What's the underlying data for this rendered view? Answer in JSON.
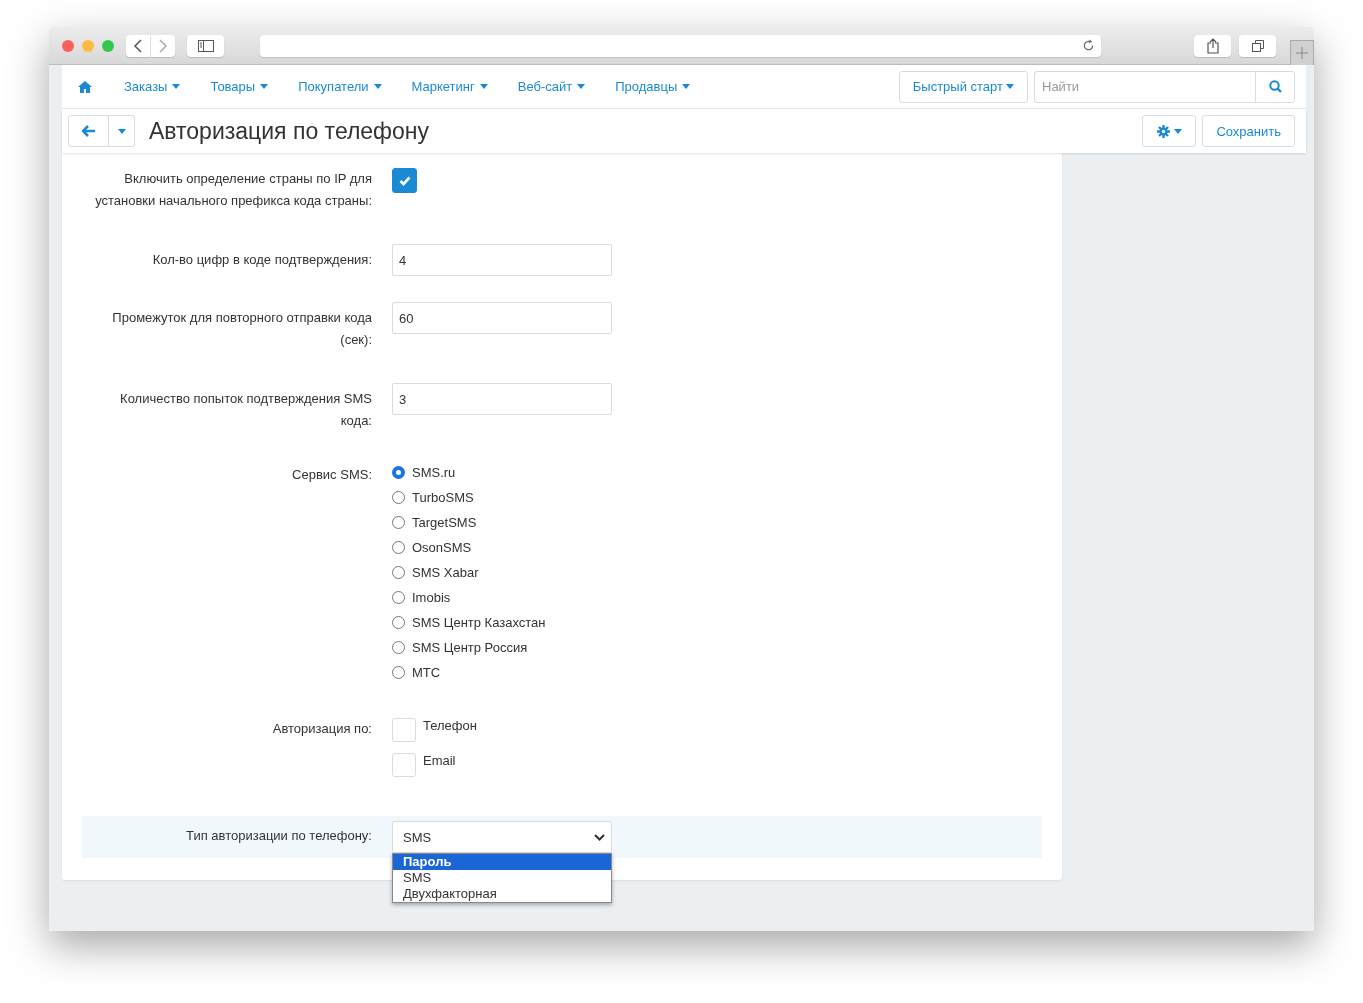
{
  "nav": {
    "items": [
      {
        "label": "Заказы"
      },
      {
        "label": "Товары"
      },
      {
        "label": "Покупатели"
      },
      {
        "label": "Маркетинг"
      },
      {
        "label": "Веб-сайт"
      },
      {
        "label": "Продавцы"
      }
    ],
    "quick_start": "Быстрый старт",
    "search": {
      "placeholder": "Найти"
    }
  },
  "header": {
    "title": "Авторизация по телефону",
    "save": "Сохранить"
  },
  "form": [
    {
      "kind": "checkbox",
      "label": "Включить определение страны по IP для установки начального префикса кода страны:",
      "checked": true
    },
    {
      "kind": "input",
      "label": "Кол-во цифр в коде подтверждения:",
      "value": "4"
    },
    {
      "kind": "input",
      "label": "Промежуток для повторного отправки кода (сек):",
      "value": "60"
    },
    {
      "kind": "input",
      "label": "Количество попыток подтверждения SMS кода:",
      "value": "3"
    },
    {
      "kind": "radio",
      "label": "Сервис SMS:",
      "options": [
        {
          "label": "SMS.ru",
          "selected": true
        },
        {
          "label": "TurboSMS",
          "selected": false
        },
        {
          "label": "TargetSMS",
          "selected": false
        },
        {
          "label": "OsonSMS",
          "selected": false
        },
        {
          "label": "SMS Xabar",
          "selected": false
        },
        {
          "label": "Imobis",
          "selected": false
        },
        {
          "label": "SMS Центр Казахстан",
          "selected": false
        },
        {
          "label": "SMS Центр Россия",
          "selected": false
        },
        {
          "label": "МТС",
          "selected": false
        }
      ]
    },
    {
      "kind": "checkboxes",
      "label": "Авторизация по:",
      "options": [
        {
          "label": "Телефон",
          "checked": false
        },
        {
          "label": "Email",
          "checked": false
        }
      ]
    },
    {
      "kind": "select",
      "label": "Тип авторизации по телефону:",
      "value": "SMS",
      "expanded": true,
      "options": [
        {
          "label": "Пароль",
          "highlighted": true
        },
        {
          "label": "SMS",
          "highlighted": false
        },
        {
          "label": "Двухфакторная",
          "highlighted": false
        }
      ]
    }
  ]
}
